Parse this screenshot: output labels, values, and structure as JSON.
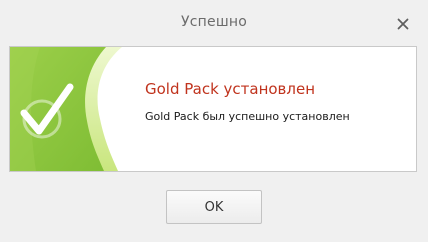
{
  "dialog": {
    "title": "Успешно",
    "close_icon": "close-icon",
    "success_icon": "checkmark-icon",
    "heading": "Gold Pack установлен",
    "message": "Gold Pack был успешно установлен",
    "ok_label": "OK"
  },
  "colors": {
    "window_background": "#f0f0f0",
    "heading_text": "#c0331d",
    "banner_green": "#8cc63f",
    "banner_light_green": "#d8ee9c"
  }
}
